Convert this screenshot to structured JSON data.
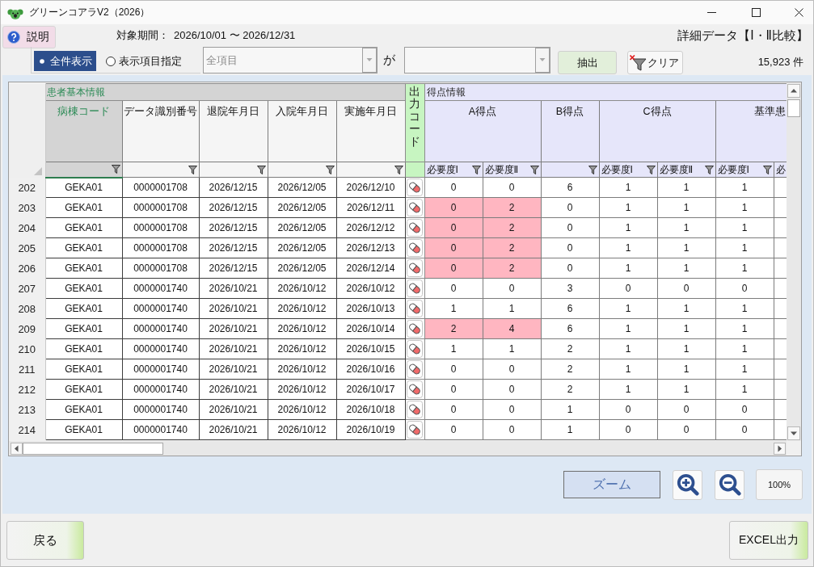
{
  "window": {
    "title": "グリーンコアラV2（2026）"
  },
  "help_button": {
    "label": "説明"
  },
  "period": {
    "label": "対象期間：",
    "value": "2026/10/01 〜 2026/12/31"
  },
  "screen_title": "詳細データ【Ⅰ・Ⅱ比較】",
  "display_modes": [
    {
      "label": "全件表示",
      "selected": true
    },
    {
      "label": "表示項目指定",
      "selected": false
    }
  ],
  "item_select": {
    "value": "全項目",
    "disabled": true
  },
  "connector": "が",
  "condition_select": {
    "disabled": true
  },
  "extract_button": {
    "label": "抽出"
  },
  "clear_button": {
    "label": "クリア"
  },
  "record_count": "15,923 件",
  "table": {
    "patient_group": {
      "label": "患者基本情報",
      "columns": [
        {
          "label": "病棟コード",
          "selected": true
        },
        {
          "label": "データ識別番号",
          "selected": false
        },
        {
          "label": "退院年月日",
          "selected": false
        },
        {
          "label": "入院年月日",
          "selected": false
        },
        {
          "label": "実施年月日",
          "selected": false
        }
      ]
    },
    "output_column": {
      "label": "出力コード"
    },
    "score_group": {
      "label": "得点情報",
      "columns": [
        {
          "label": "A得点",
          "subcolumns": [
            "必要度Ⅰ",
            "必要度Ⅱ"
          ]
        },
        {
          "label": "B得点"
        },
        {
          "label": "C得点",
          "subcolumns": [
            "必要度Ⅰ",
            "必要度Ⅱ"
          ]
        },
        {
          "label": "基準患",
          "subcolumns": [
            "必要度Ⅰ",
            "必"
          ]
        }
      ]
    },
    "rows": [
      {
        "number": "202",
        "cells": [
          "GEKA01",
          "0000001708",
          "2026/12/15",
          "2026/12/05",
          "2026/12/10"
        ],
        "scores": [
          {
            "value": "0",
            "alert": false
          },
          {
            "value": "0",
            "alert": false
          },
          {
            "value": "6",
            "alert": false
          },
          {
            "value": "1",
            "alert": false
          },
          {
            "value": "1",
            "alert": false
          },
          {
            "value": "1",
            "alert": false
          }
        ]
      },
      {
        "number": "203",
        "cells": [
          "GEKA01",
          "0000001708",
          "2026/12/15",
          "2026/12/05",
          "2026/12/11"
        ],
        "scores": [
          {
            "value": "0",
            "alert": true
          },
          {
            "value": "2",
            "alert": true
          },
          {
            "value": "0",
            "alert": false
          },
          {
            "value": "1",
            "alert": false
          },
          {
            "value": "1",
            "alert": false
          },
          {
            "value": "1",
            "alert": false
          }
        ]
      },
      {
        "number": "204",
        "cells": [
          "GEKA01",
          "0000001708",
          "2026/12/15",
          "2026/12/05",
          "2026/12/12"
        ],
        "scores": [
          {
            "value": "0",
            "alert": true
          },
          {
            "value": "2",
            "alert": true
          },
          {
            "value": "0",
            "alert": false
          },
          {
            "value": "1",
            "alert": false
          },
          {
            "value": "1",
            "alert": false
          },
          {
            "value": "1",
            "alert": false
          }
        ]
      },
      {
        "number": "205",
        "cells": [
          "GEKA01",
          "0000001708",
          "2026/12/15",
          "2026/12/05",
          "2026/12/13"
        ],
        "scores": [
          {
            "value": "0",
            "alert": true
          },
          {
            "value": "2",
            "alert": true
          },
          {
            "value": "0",
            "alert": false
          },
          {
            "value": "1",
            "alert": false
          },
          {
            "value": "1",
            "alert": false
          },
          {
            "value": "1",
            "alert": false
          }
        ]
      },
      {
        "number": "206",
        "cells": [
          "GEKA01",
          "0000001708",
          "2026/12/15",
          "2026/12/05",
          "2026/12/14"
        ],
        "scores": [
          {
            "value": "0",
            "alert": true
          },
          {
            "value": "2",
            "alert": true
          },
          {
            "value": "0",
            "alert": false
          },
          {
            "value": "1",
            "alert": false
          },
          {
            "value": "1",
            "alert": false
          },
          {
            "value": "1",
            "alert": false
          }
        ]
      },
      {
        "number": "207",
        "cells": [
          "GEKA01",
          "0000001740",
          "2026/10/21",
          "2026/10/12",
          "2026/10/12"
        ],
        "scores": [
          {
            "value": "0",
            "alert": false
          },
          {
            "value": "0",
            "alert": false
          },
          {
            "value": "3",
            "alert": false
          },
          {
            "value": "0",
            "alert": false
          },
          {
            "value": "0",
            "alert": false
          },
          {
            "value": "0",
            "alert": false
          }
        ]
      },
      {
        "number": "208",
        "cells": [
          "GEKA01",
          "0000001740",
          "2026/10/21",
          "2026/10/12",
          "2026/10/13"
        ],
        "scores": [
          {
            "value": "1",
            "alert": false
          },
          {
            "value": "1",
            "alert": false
          },
          {
            "value": "6",
            "alert": false
          },
          {
            "value": "1",
            "alert": false
          },
          {
            "value": "1",
            "alert": false
          },
          {
            "value": "1",
            "alert": false
          }
        ]
      },
      {
        "number": "209",
        "cells": [
          "GEKA01",
          "0000001740",
          "2026/10/21",
          "2026/10/12",
          "2026/10/14"
        ],
        "scores": [
          {
            "value": "2",
            "alert": true
          },
          {
            "value": "4",
            "alert": true
          },
          {
            "value": "6",
            "alert": false
          },
          {
            "value": "1",
            "alert": false
          },
          {
            "value": "1",
            "alert": false
          },
          {
            "value": "1",
            "alert": false
          }
        ]
      },
      {
        "number": "210",
        "cells": [
          "GEKA01",
          "0000001740",
          "2026/10/21",
          "2026/10/12",
          "2026/10/15"
        ],
        "scores": [
          {
            "value": "1",
            "alert": false
          },
          {
            "value": "1",
            "alert": false
          },
          {
            "value": "2",
            "alert": false
          },
          {
            "value": "1",
            "alert": false
          },
          {
            "value": "1",
            "alert": false
          },
          {
            "value": "1",
            "alert": false
          }
        ]
      },
      {
        "number": "211",
        "cells": [
          "GEKA01",
          "0000001740",
          "2026/10/21",
          "2026/10/12",
          "2026/10/16"
        ],
        "scores": [
          {
            "value": "0",
            "alert": false
          },
          {
            "value": "0",
            "alert": false
          },
          {
            "value": "2",
            "alert": false
          },
          {
            "value": "1",
            "alert": false
          },
          {
            "value": "1",
            "alert": false
          },
          {
            "value": "1",
            "alert": false
          }
        ]
      },
      {
        "number": "212",
        "cells": [
          "GEKA01",
          "0000001740",
          "2026/10/21",
          "2026/10/12",
          "2026/10/17"
        ],
        "scores": [
          {
            "value": "0",
            "alert": false
          },
          {
            "value": "0",
            "alert": false
          },
          {
            "value": "2",
            "alert": false
          },
          {
            "value": "1",
            "alert": false
          },
          {
            "value": "1",
            "alert": false
          },
          {
            "value": "1",
            "alert": false
          }
        ]
      },
      {
        "number": "213",
        "cells": [
          "GEKA01",
          "0000001740",
          "2026/10/21",
          "2026/10/12",
          "2026/10/18"
        ],
        "scores": [
          {
            "value": "0",
            "alert": false
          },
          {
            "value": "0",
            "alert": false
          },
          {
            "value": "1",
            "alert": false
          },
          {
            "value": "0",
            "alert": false
          },
          {
            "value": "0",
            "alert": false
          },
          {
            "value": "0",
            "alert": false
          }
        ]
      },
      {
        "number": "214",
        "cells": [
          "GEKA01",
          "0000001740",
          "2026/10/21",
          "2026/10/12",
          "2026/10/19"
        ],
        "scores": [
          {
            "value": "0",
            "alert": false
          },
          {
            "value": "0",
            "alert": false
          },
          {
            "value": "1",
            "alert": false
          },
          {
            "value": "0",
            "alert": false
          },
          {
            "value": "0",
            "alert": false
          },
          {
            "value": "0",
            "alert": false
          }
        ]
      }
    ]
  },
  "zoom": {
    "label": "ズーム",
    "reset_button": "100%"
  },
  "back_button": {
    "label": "戻る"
  },
  "excel_button": {
    "label": "EXCEL出力"
  }
}
